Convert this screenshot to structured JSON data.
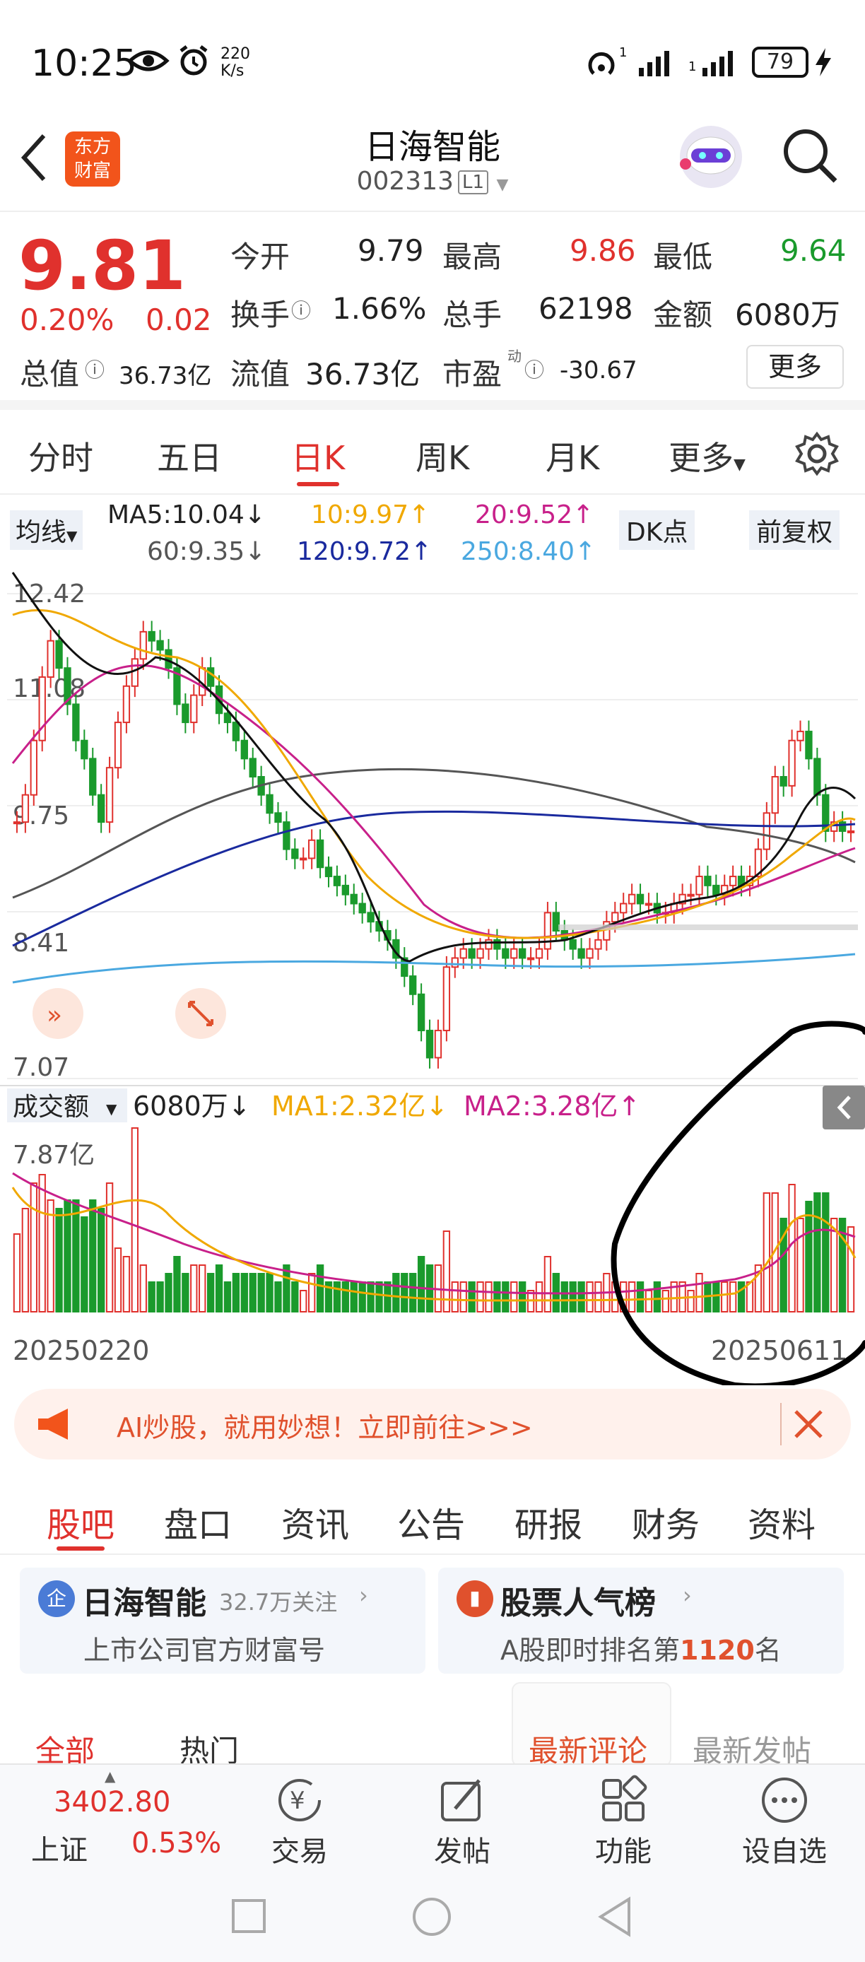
{
  "status": {
    "time": "10:25",
    "speed_top": "220",
    "speed_bottom": "K/s",
    "sim1": "1",
    "sim2": "1",
    "battery": "79"
  },
  "header": {
    "title": "日海智能",
    "code": "002313",
    "code_badge": "L1",
    "logo_line1": "东方",
    "logo_line2": "财富"
  },
  "quote": {
    "price": "9.81",
    "pct": "0.20%",
    "chg": "0.02",
    "open_label": "今开",
    "open": "9.79",
    "high_label": "最高",
    "high": "9.86",
    "low_label": "最低",
    "low": "9.64",
    "turnover_label": "换手",
    "turnover": "1.66%",
    "volume_label": "总手",
    "volume": "62198",
    "amount_label": "金额",
    "amount": "6080万",
    "total_cap_label": "总值",
    "total_cap": "36.73亿",
    "float_cap_label": "流值",
    "float_cap": "36.73亿",
    "pe_label": "市盈",
    "pe_sup": "动",
    "pe": "-30.67",
    "more": "更多"
  },
  "period_tabs": [
    "分时",
    "五日",
    "日K",
    "周K",
    "月K",
    "更多"
  ],
  "ma": {
    "selector": "均线",
    "ma5": "MA5:10.04↓",
    "ma10": "10:9.97↑",
    "ma20": "20:9.52↑",
    "ma60": "60:9.35↓",
    "ma120": "120:9.72↑",
    "ma250": "250:8.40↑",
    "dk": "DK点",
    "adjust": "前复权"
  },
  "chart": {
    "y_labels": [
      "12.42",
      "11.08",
      "9.75",
      "8.41",
      "7.07"
    ],
    "vol_selector": "成交额",
    "vol_value": "6080万↓",
    "vol_ma1": "MA1:2.32亿↓",
    "vol_ma2": "MA2:3.28亿↑",
    "vol_max": "7.87亿",
    "date_start": "20250220",
    "date_end": "20250611"
  },
  "chart_data": {
    "type": "candlestick",
    "ylim": [
      7.07,
      12.42
    ],
    "ticks": [
      12.42,
      11.08,
      9.75,
      8.41,
      7.07
    ],
    "x_range": [
      "20250220",
      "20250611"
    ],
    "ma_latest": {
      "MA5": 10.04,
      "MA10": 9.97,
      "MA20": 9.52,
      "MA60": 9.35,
      "MA120": 9.72,
      "MA250": 8.4
    },
    "volume_max_label": "7.87亿",
    "latest": {
      "close": 9.81,
      "open": 9.79,
      "high": 9.86,
      "low": 9.64
    }
  },
  "ad": {
    "text": "AI炒股，就用妙想！立即前往>>>"
  },
  "info_tabs": [
    "股吧",
    "盘口",
    "资讯",
    "公告",
    "研报",
    "财务",
    "资料"
  ],
  "cards": {
    "left_title": "日海智能",
    "left_follow": "32.7万关注",
    "left_sub": "上市公司官方财富号",
    "right_title": "股票人气榜",
    "right_sub_prefix": "A股即时排名第",
    "right_rank": "1120",
    "right_sub_suffix": "名"
  },
  "sub_tabs": {
    "all": "全部",
    "hot": "热门",
    "latest_comment": "最新评论",
    "latest_post": "最新发帖"
  },
  "bottom_nav": {
    "index_value": "3402.80",
    "index_name": "上证",
    "index_pct": "0.53%",
    "trade": "交易",
    "post": "发帖",
    "func": "功能",
    "watch": "设自选"
  }
}
